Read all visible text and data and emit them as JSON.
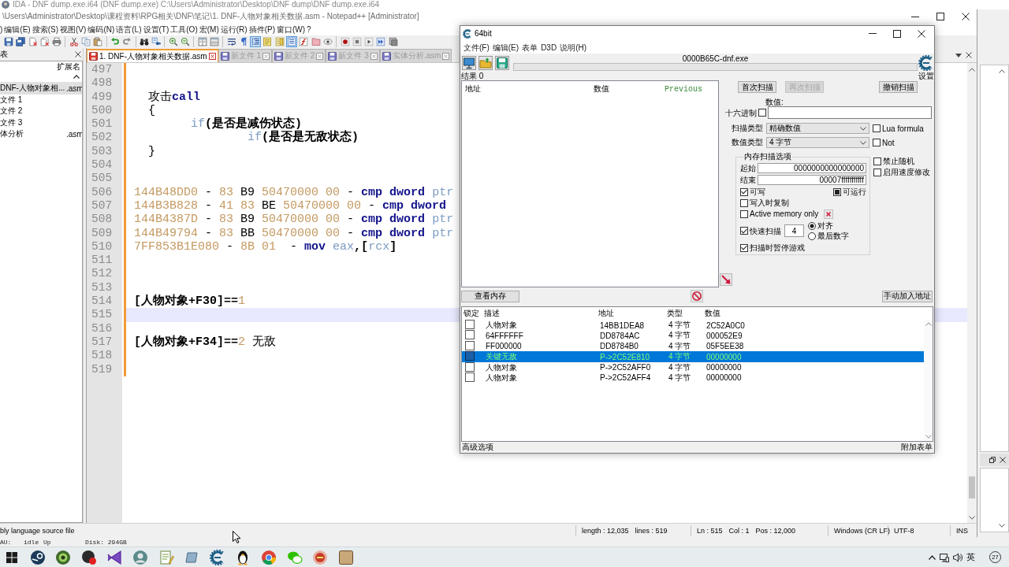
{
  "ida": {
    "title": "IDA - DNF dump.exe.i64 (DNF dump.exe) C:\\Users\\Administrator\\Desktop\\DNF dump\\DNF dump.exe.i64",
    "status_bar": [
      "AU:",
      "idle",
      "Up",
      "Disk: 294GB"
    ]
  },
  "notepad": {
    "title": "\\Users\\Administrator\\Desktop\\课程资料\\RPG相关\\DNF\\笔记\\1. DNF-人物对象相关数据.asm - Notepad++ [Administrator]",
    "menu": [
      ")",
      "编辑(E)",
      "搜索(S)",
      "视图(V)",
      "编码(N)",
      "语言(L)",
      "设置(T)",
      "工具(O)",
      "宏(M)",
      "运行(R)",
      "插件(P)",
      "窗口(W)",
      "?"
    ],
    "toolbar": [
      {
        "pressed": false
      },
      {
        "pressed": false
      },
      {
        "pressed": false
      },
      {
        "pressed": false
      },
      {
        "pressed": false
      },
      {
        "pressed": false
      },
      {
        "pressed": false
      },
      {
        "pressed": false
      },
      {
        "pressed": false
      },
      {
        "pressed": false
      },
      {
        "pressed": false
      },
      {
        "pressed": false
      },
      {
        "pressed": false
      },
      {
        "pressed": false
      },
      {
        "pressed": false
      },
      {
        "pressed": false
      },
      {
        "pressed": false
      },
      {
        "pressed": false
      },
      {
        "pressed": true
      },
      {
        "pressed": false
      },
      {
        "pressed": false
      },
      {
        "pressed": true
      },
      {
        "pressed": false
      },
      {
        "pressed": false
      },
      {
        "pressed": false
      },
      {
        "pressed": false
      },
      {
        "pressed": false
      },
      {
        "pressed": false
      },
      {
        "pressed": false
      },
      {
        "pressed": false
      }
    ],
    "doc_list": {
      "title": "表",
      "column": "扩展名",
      "items": [
        {
          "name": "DNF-人物对象相...",
          "ext": ".asm",
          "selected": true
        },
        {
          "name": "文件 1",
          "selected": false
        },
        {
          "name": "文件 2",
          "selected": false
        },
        {
          "name": "文件 3",
          "selected": false
        },
        {
          "name": "体分析",
          "ext": ".asm",
          "selected": false
        }
      ]
    },
    "tabs": [
      {
        "label": "1. DNF-人物对象相关数据.asm",
        "selected": true,
        "modified": true
      },
      {
        "label": "新文件 1",
        "selected": false,
        "modified": false
      },
      {
        "label": "新文件 2",
        "selected": false,
        "modified": false
      },
      {
        "label": "新文件 3",
        "selected": false,
        "modified": false
      },
      {
        "label": "实体分析.asm",
        "selected": false,
        "modified": false
      }
    ],
    "editor": {
      "lines": [
        {
          "number": "497",
          "current": false,
          "modified": true
        },
        {
          "number": "498",
          "current": false,
          "modified": true
        },
        {
          "number": "499",
          "current": false,
          "modified": true,
          "tokens": [
            {
              "text": "  攻击",
              "kind": "plain"
            },
            {
              "text": "call",
              "kind": "keyword"
            }
          ]
        },
        {
          "number": "500",
          "current": false,
          "modified": true,
          "tokens": [
            {
              "text": "  {",
              "kind": "plain"
            }
          ]
        },
        {
          "number": "501",
          "current": false,
          "modified": true,
          "tokens": [
            {
              "text": "\tif",
              "kind": "register"
            },
            {
              "text": "(是否是减伤状态)",
              "kind": "operator"
            }
          ]
        },
        {
          "number": "502",
          "current": false,
          "modified": true,
          "tokens": [
            {
              "text": "\t\tif",
              "kind": "register"
            },
            {
              "text": "(是否是无敌状态)",
              "kind": "operator"
            }
          ]
        },
        {
          "number": "503",
          "current": false,
          "modified": true,
          "tokens": [
            {
              "text": "  }",
              "kind": "plain"
            }
          ]
        },
        {
          "number": "504",
          "current": false,
          "modified": true
        },
        {
          "number": "505",
          "current": false,
          "modified": true
        },
        {
          "number": "506",
          "current": false,
          "modified": true,
          "tokens": [
            {
              "text": "144B48DD0",
              "kind": "number"
            },
            {
              "text": " - ",
              "kind": "plain"
            },
            {
              "text": "83",
              "kind": "number"
            },
            {
              "text": " B9 ",
              "kind": "plain"
            },
            {
              "text": "50470000 00",
              "kind": "number"
            },
            {
              "text": " - ",
              "kind": "plain"
            },
            {
              "text": "cmp dword",
              "kind": "keyword"
            },
            {
              "text": " ptr",
              "kind": "register"
            }
          ]
        },
        {
          "number": "507",
          "current": false,
          "modified": true,
          "tokens": [
            {
              "text": "144B3B828",
              "kind": "number"
            },
            {
              "text": " - ",
              "kind": "plain"
            },
            {
              "text": "41 83",
              "kind": "number"
            },
            {
              "text": " BE ",
              "kind": "plain"
            },
            {
              "text": "50470000 00",
              "kind": "number"
            },
            {
              "text": " - ",
              "kind": "plain"
            },
            {
              "text": "cmp dword",
              "kind": "keyword"
            }
          ]
        },
        {
          "number": "508",
          "current": false,
          "modified": true,
          "tokens": [
            {
              "text": "144B4387D",
              "kind": "number"
            },
            {
              "text": " - ",
              "kind": "plain"
            },
            {
              "text": "83",
              "kind": "number"
            },
            {
              "text": " B9 ",
              "kind": "plain"
            },
            {
              "text": "50470000 00",
              "kind": "number"
            },
            {
              "text": " - ",
              "kind": "plain"
            },
            {
              "text": "cmp dword",
              "kind": "keyword"
            },
            {
              "text": " ptr",
              "kind": "register"
            }
          ]
        },
        {
          "number": "509",
          "current": false,
          "modified": true,
          "tokens": [
            {
              "text": "144B49794",
              "kind": "number"
            },
            {
              "text": " - ",
              "kind": "plain"
            },
            {
              "text": "83",
              "kind": "number"
            },
            {
              "text": " BB ",
              "kind": "plain"
            },
            {
              "text": "50470000 00",
              "kind": "number"
            },
            {
              "text": " - ",
              "kind": "plain"
            },
            {
              "text": "cmp dword",
              "kind": "keyword"
            },
            {
              "text": " ptr",
              "kind": "register"
            }
          ]
        },
        {
          "number": "510",
          "current": false,
          "modified": true,
          "tokens": [
            {
              "text": "7FF853B1E080",
              "kind": "number"
            },
            {
              "text": " - ",
              "kind": "plain"
            },
            {
              "text": "8B 01",
              "kind": "number"
            },
            {
              "text": "  - ",
              "kind": "plain"
            },
            {
              "text": "mov",
              "kind": "keyword"
            },
            {
              "text": " eax",
              "kind": "register"
            },
            {
              "text": ",[",
              "kind": "operator"
            },
            {
              "text": "rcx",
              "kind": "register"
            },
            {
              "text": "]",
              "kind": "operator"
            }
          ]
        },
        {
          "number": "511",
          "current": false,
          "modified": true
        },
        {
          "number": "512",
          "current": false,
          "modified": true
        },
        {
          "number": "513",
          "current": false,
          "modified": true
        },
        {
          "number": "514",
          "current": false,
          "modified": true,
          "tokens": [
            {
              "text": "[人物对象+F30]==",
              "kind": "operator"
            },
            {
              "text": "1",
              "kind": "number"
            }
          ]
        },
        {
          "number": "515",
          "current": true,
          "modified": true
        },
        {
          "number": "516",
          "current": false,
          "modified": true
        },
        {
          "number": "517",
          "current": false,
          "modified": true,
          "tokens": [
            {
              "text": "[人物对象+F34]==",
              "kind": "operator"
            },
            {
              "text": "2",
              "kind": "number"
            },
            {
              "text": " 无敌",
              "kind": "plain"
            }
          ]
        },
        {
          "number": "518",
          "current": false,
          "modified": true
        },
        {
          "number": "519",
          "current": false,
          "modified": true
        }
      ]
    },
    "status_bar": {
      "file_type": "bly language source file",
      "length": "length : 12,035",
      "lines": "lines : 519",
      "caret": [
        "Ln : 515",
        "Col : 1",
        "Pos : 12,000"
      ],
      "eol": "Windows (CR LF)",
      "encoding": "UTF-8",
      "mode": "INS"
    }
  },
  "cheat_engine": {
    "title": "64bit",
    "menu": [
      "文件(F)",
      "编辑(E)",
      "表单",
      "D3D",
      "说明(H)"
    ],
    "process": "0000B65C-dnf.exe",
    "scan_progress": {
      "level": 0
    },
    "settings_label": "设置",
    "results_label": "结果 0",
    "found_list": {
      "columns": [
        "地址",
        "数值",
        "Previous"
      ]
    },
    "scan_buttons": [
      {
        "label": "首次扫描",
        "disabled": false
      },
      {
        "label": "再次扫描",
        "disabled": true
      },
      {
        "label": "撤销扫描",
        "disabled": false
      }
    ],
    "value_label": "数值:",
    "hex": {
      "label": "十六进制",
      "checked": false
    },
    "scan_type": {
      "label": "扫描类型",
      "value": "精确数值"
    },
    "value_type": {
      "label": "数值类型",
      "value": "4 字节"
    },
    "scan_flags": [
      {
        "label": "Lua formula",
        "checked": false
      },
      {
        "label": "Not",
        "checked": false
      }
    ],
    "memory_options": {
      "title": "内存扫描选项",
      "range": [
        {
          "label": "起始",
          "value": "0000000000000000"
        },
        {
          "label": "结束",
          "value": "00007fffffffffff"
        }
      ],
      "writable": {
        "label": "可写",
        "checked": true
      },
      "executable": {
        "label": "可运行",
        "indeterminate": true
      },
      "copy_on_write": {
        "label": "写入时复制",
        "checked": false
      },
      "active_memory_only": {
        "label": "Active memory only",
        "checked": false
      },
      "fast_scan": {
        "label": "快速扫描",
        "checked": true,
        "value": "4"
      },
      "alignment": [
        {
          "label": "对齐",
          "selected": true
        },
        {
          "label": "最后数字",
          "selected": false
        }
      ],
      "pause_game": {
        "label": "扫描时暂停游戏",
        "checked": true
      }
    },
    "extra_flags": [
      {
        "label": "禁止随机",
        "checked": false
      },
      {
        "label": "启用速度修改",
        "checked": false
      }
    ],
    "view_memory_button": "查看内存",
    "add_address_button": "手动加入地址",
    "address_table": {
      "columns": [
        "锁定",
        "描述",
        "地址",
        "类型",
        "数值"
      ],
      "rows": [
        {
          "locked": false,
          "selected": false,
          "description": "人物对象",
          "address": "14BB1DEA8",
          "type": "4 字节",
          "value": "2C52A0C0"
        },
        {
          "locked": false,
          "selected": false,
          "description": "64FFFFFF",
          "address": "DD8784AC",
          "type": "4 字节",
          "value": "000052E9"
        },
        {
          "locked": false,
          "selected": false,
          "description": "FF000000",
          "address": "DD8784B0",
          "type": "4 字节",
          "value": "05F5EE38"
        },
        {
          "locked": false,
          "selected": true,
          "description": "关键无敌",
          "address": "P->2C52E810",
          "type": "4 字节",
          "value": "00000000"
        },
        {
          "locked": false,
          "selected": false,
          "description": "人物对象",
          "address": "P->2C52AFF0",
          "type": "4 字节",
          "value": "00000000"
        },
        {
          "locked": false,
          "selected": false,
          "description": "人物对象",
          "address": "P->2C52AFF4",
          "type": "4 字节",
          "value": "00000000"
        }
      ]
    },
    "footer": {
      "left": "高级选项",
      "right": "附加表单"
    }
  },
  "taskbar": {
    "tray": {
      "language": "英",
      "notification_count": "27"
    }
  }
}
